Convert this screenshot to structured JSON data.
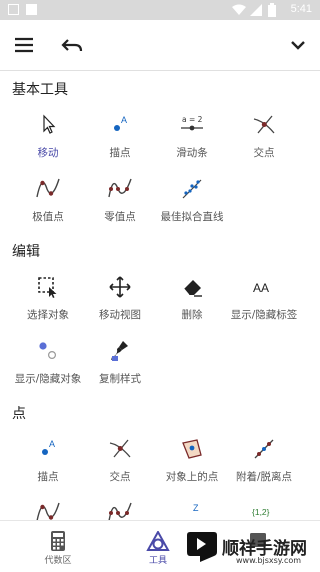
{
  "status_bar": {
    "time": "5:41"
  },
  "sections": [
    {
      "title": "基本工具",
      "tools": [
        {
          "label": "移动",
          "icon": "move-cursor-icon",
          "active": true
        },
        {
          "label": "描点",
          "icon": "point-icon"
        },
        {
          "label": "滑动条",
          "icon": "slider-icon",
          "glyph": "a = 2"
        },
        {
          "label": "交点",
          "icon": "intersect-icon"
        },
        {
          "label": "极值点",
          "icon": "extremum-icon"
        },
        {
          "label": "零值点",
          "icon": "roots-icon"
        },
        {
          "label": "最佳拟合直线",
          "icon": "best-fit-line-icon"
        }
      ]
    },
    {
      "title": "编辑",
      "tools": [
        {
          "label": "选择对象",
          "icon": "select-objects-icon"
        },
        {
          "label": "移动视图",
          "icon": "move-view-icon"
        },
        {
          "label": "删除",
          "icon": "delete-eraser-icon"
        },
        {
          "label": "显示/隐藏标签",
          "icon": "show-hide-label-icon",
          "glyph": "AA"
        },
        {
          "label": "显示/隐藏对象",
          "icon": "show-hide-object-icon"
        },
        {
          "label": "复制样式",
          "icon": "copy-style-icon"
        }
      ]
    },
    {
      "title": "点",
      "tools": [
        {
          "label": "描点",
          "icon": "point-icon"
        },
        {
          "label": "交点",
          "icon": "intersect-icon"
        },
        {
          "label": "对象上的点",
          "icon": "point-on-object-icon"
        },
        {
          "label": "附着/脱离点",
          "icon": "attach-detach-point-icon"
        },
        {
          "label": "",
          "icon": "extremum-icon"
        },
        {
          "label": "",
          "icon": "roots-icon"
        },
        {
          "label": "",
          "icon": "complex-number-icon",
          "glyph": "Z"
        },
        {
          "label": "",
          "icon": "list-icon",
          "glyph": "{1,2}"
        }
      ]
    }
  ],
  "bottom_nav": [
    {
      "label": "代数区",
      "icon": "calculator-icon"
    },
    {
      "label": "工具",
      "icon": "tools-icon",
      "active": true
    }
  ],
  "watermark": {
    "text": "顺祥手游网",
    "url": "www.bjsxsy.com"
  },
  "colors": {
    "accent": "#4a4aa8",
    "point": "#1565c0",
    "curve": "#7a2a2a",
    "status_bar": "#d9d9d9"
  }
}
